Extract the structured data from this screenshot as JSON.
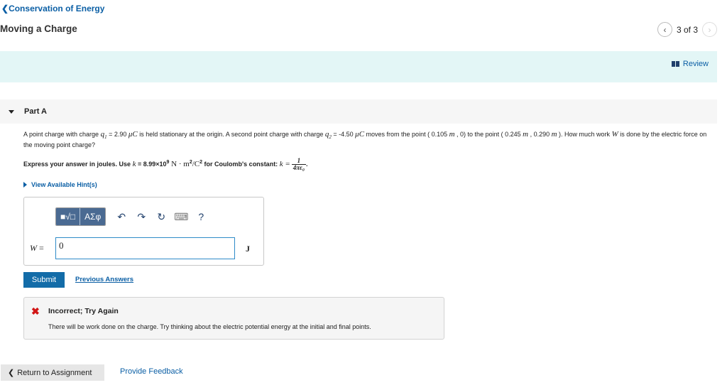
{
  "nav": {
    "back_link": "Conservation of Energy",
    "title": "Moving a Charge",
    "page_indicator": "3 of 3",
    "review_label": "Review"
  },
  "part": {
    "label": "Part A",
    "question_1": "A point charge with charge ",
    "q1_sym": "q",
    "q1_sub": "1",
    "q1_val": " = 2.90 ",
    "unit_mu": "μC",
    "question_2": " is held stationary at the origin. A second point charge with charge ",
    "q2_sym": "q",
    "q2_sub": "2",
    "q2_val": " = -4.50 ",
    "question_3": " moves from the point ( 0.105 ",
    "unit_m": "m",
    "question_4": " , 0) to the point ( 0.245 ",
    "question_5": " , 0.290 ",
    "question_6": " ). How much work ",
    "w_sym": "W",
    "question_7": " is done by the electric force on the moving point charge?",
    "instruction_1": "Express your answer in joules. Use ",
    "k_sym": "k",
    "instruction_2": " = 8.99×10",
    "exp9": "9",
    "unit_nm": " N · m",
    "exp2": "2",
    "unit_c": "/C",
    "instruction_3": " for Coulomb's constant: ",
    "k_eq": "k =",
    "frac_num": "1",
    "frac_den": "4πε₀",
    "instruction_end": ".",
    "hint_label": "View Available Hint(s)"
  },
  "answer": {
    "toolbar": {
      "template_btn": "■√□",
      "symbols_btn": "ΑΣφ",
      "undo": "↶",
      "redo": "↷",
      "reset": "↻",
      "keyboard": "⌨",
      "help": "?"
    },
    "variable": "W",
    "equals": " =",
    "value": "0",
    "unit": "J",
    "submit_label": "Submit",
    "previous_answers_label": "Previous Answers"
  },
  "feedback": {
    "icon": "✖",
    "title": "Incorrect; Try Again",
    "message": "There will be work done on the charge. Try thinking about the electric potential energy at the initial and final points."
  },
  "footer": {
    "return_label": "Return to Assignment",
    "feedback_label": "Provide Feedback"
  }
}
